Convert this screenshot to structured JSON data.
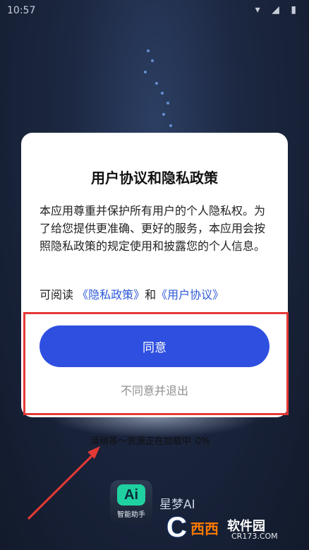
{
  "status_bar": {
    "time": "10:57",
    "icons": "◉ ✆ ▣",
    "right_icons": "▾ ◢ ▮"
  },
  "loading": {
    "text": "请稍等～资源正在加载中",
    "percent": "0%"
  },
  "app": {
    "logo_mark": "Ai",
    "logo_caption": "智能助手",
    "name": "星梦AI"
  },
  "dialog": {
    "title": "用户协议和隐私政策",
    "body": "本应用尊重并保护所有用户的个人隐私权。为了给您提供更准确、更好的服务，本应用会按照隐私政策的规定使用和披露您的个人信息。",
    "read_prefix": "可阅读",
    "privacy_link": "《隐私政策》",
    "and": "和",
    "agreement_link": "《用户协议》",
    "agree_label": "同意",
    "disagree_label": "不同意并退出"
  },
  "watermark": {
    "mark": "C",
    "brand": "西西",
    "name": "软件园",
    "url": "CR173.COM"
  },
  "colors": {
    "accent": "#2e4fe0",
    "link": "#2e59d9",
    "highlight": "#e53935"
  }
}
